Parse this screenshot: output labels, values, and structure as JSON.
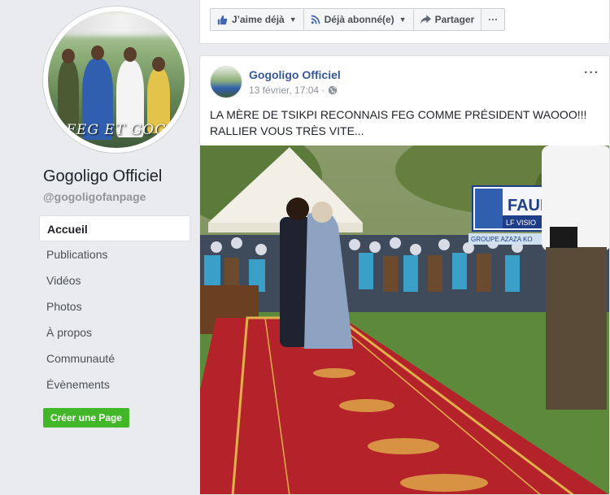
{
  "page": {
    "name": "Gogoligo Officiel",
    "handle": "@gogoligofanpage",
    "avatar_caption": "FEG ET GOG"
  },
  "nav": {
    "items": [
      "Accueil",
      "Publications",
      "Vidéos",
      "Photos",
      "À propos",
      "Communauté",
      "Évènements"
    ],
    "active": "Accueil"
  },
  "create_page_label": "Créer une Page",
  "action_bar": {
    "like_label": "J’aime déjà",
    "follow_label": "Déjà abonné(e)",
    "share_label": "Partager",
    "more_label": "···"
  },
  "post": {
    "author": "Gogoligo Officiel",
    "timestamp": "13 février, 17:04 ·",
    "text": "LA MÈRE DE TSIKPI RECONNAIS FEG COMME PRÉSIDENT WAOOO!!! RALLIER VOUS TRÈS VITE...",
    "more_label": "···"
  },
  "photo": {
    "banner_text": "FAUR",
    "banner_sub": "LF VISIO",
    "sign_text": "GROUPE AZAZA KO"
  },
  "colors": {
    "background": "#e9ebee",
    "link_blue": "#365899",
    "green_button": "#42b72a",
    "carpet_red": "#b5232a"
  },
  "icons": {
    "like": "thumbs-up-icon",
    "follow": "rss-icon",
    "share": "share-arrow-icon",
    "audience": "globe-icon",
    "caret": "chevron-down-icon"
  }
}
